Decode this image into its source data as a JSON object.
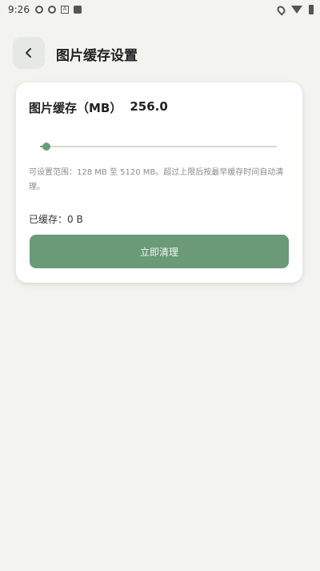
{
  "status_bar": {
    "time": "9:26"
  },
  "header": {
    "title": "图片缓存设置"
  },
  "cache": {
    "label": "图片缓存（MB）",
    "value": "256.0",
    "slider_value": 256,
    "slider_min": 128,
    "slider_max": 5120,
    "hint": "可设置范围：128 MB 至 5120 MB。超过上限后按最早缓存时间自动清理。",
    "cached_text": "已缓存：0 B",
    "clear_button": "立即清理"
  },
  "colors": {
    "accent": "#6a9a77",
    "background": "#f3f4ef"
  }
}
